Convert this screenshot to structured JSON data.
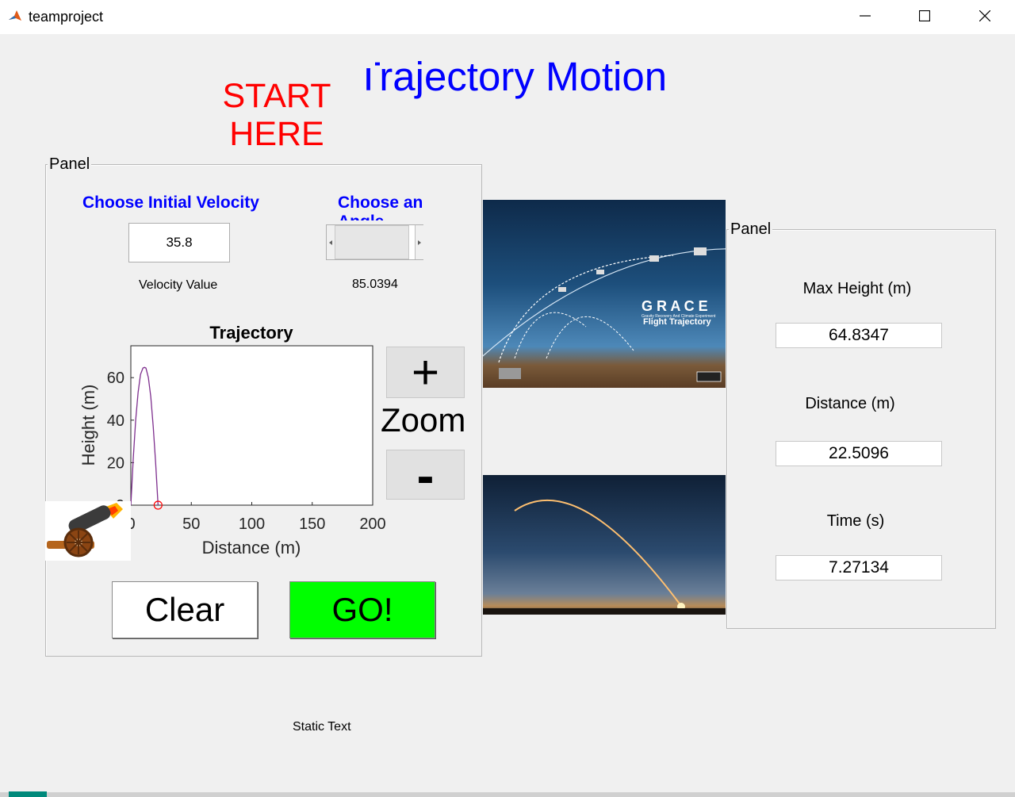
{
  "window": {
    "title": "teamproject",
    "controls": [
      "minimize",
      "maximize",
      "close"
    ]
  },
  "header": {
    "title": "Trajectory Motion",
    "start_label_line1": "START",
    "start_label_line2": "HERE"
  },
  "input_panel": {
    "label": "Panel",
    "velocity_heading": "Choose Initial Velocity",
    "velocity_input_value": "35.8",
    "velocity_caption": "Velocity Value",
    "angle_heading": "Choose an Angle",
    "angle_value": "85.0394",
    "slider_min": 0,
    "slider_max": 90,
    "slider_fraction": 0.0
  },
  "zoom": {
    "plus_label": "+",
    "zoom_label": "Zoom",
    "minus_label": "-"
  },
  "buttons": {
    "clear_label": "Clear",
    "go_label": "GO!",
    "go_color": "#00ff00"
  },
  "results_panel": {
    "label": "Panel",
    "max_height_label": "Max Height (m)",
    "max_height_value": "64.8347",
    "distance_label": "Distance (m)",
    "distance_value": "22.5096",
    "time_label": "Time (s)",
    "time_value": "7.27134"
  },
  "static_text": "Static Text",
  "images": {
    "grace_title": "G R A C E",
    "grace_subtitle": "Flight Trajectory",
    "grace_tagline": "Gravity Recovery And Climate Experiment"
  },
  "chart_data": {
    "type": "line",
    "title": "Trajectory",
    "xlabel": "Distance (m)",
    "ylabel": "Height (m)",
    "xlim": [
      0,
      200
    ],
    "ylim": [
      0,
      75
    ],
    "xticks": [
      "0",
      "50",
      "100",
      "150",
      "200"
    ],
    "yticks": [
      "0",
      "20",
      "40",
      "60"
    ],
    "series": [
      {
        "color": "#7e2f8e",
        "x": [
          0,
          2,
          4,
          6,
          8,
          10,
          11.25,
          12.5,
          14.5,
          16.5,
          18.5,
          20.5,
          22.51
        ],
        "y": [
          0,
          22,
          40,
          53,
          61.5,
          64.5,
          64.83,
          64.5,
          60,
          51,
          37,
          20,
          0
        ]
      }
    ],
    "marker": {
      "x": 22.51,
      "y": 0,
      "color": "#ff0000"
    }
  }
}
